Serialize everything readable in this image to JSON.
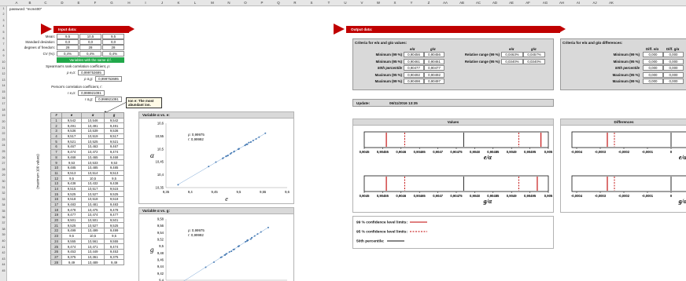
{
  "sheet": {
    "columns": [
      "A",
      "B",
      "C",
      "D",
      "E",
      "F",
      "G",
      "H",
      "I",
      "J",
      "K",
      "L",
      "M",
      "N",
      "O",
      "P",
      "Q",
      "R",
      "S",
      "T",
      "U",
      "V",
      "W",
      "X",
      "Y",
      "Z",
      "AA",
      "AB",
      "AC",
      "AD",
      "AE",
      "AF",
      "AG",
      "AH",
      "AI",
      "AJ",
      "AK"
    ],
    "rows": [
      "1",
      "2",
      "3",
      "4",
      "5",
      "6",
      "7",
      "8",
      "9",
      "10",
      "11",
      "12",
      "13",
      "14",
      "15",
      "16",
      "17",
      "18",
      "19",
      "20",
      "21",
      "22",
      "23",
      "24",
      "25",
      "26",
      "27",
      "28",
      "29",
      "30",
      "31",
      "32",
      "33",
      "34",
      "35",
      "36",
      "37",
      "38",
      "39",
      "40",
      "41",
      "42",
      "43",
      "44",
      "45"
    ],
    "password_note": "password: \"mcm400\""
  },
  "input": {
    "banner": "Input data:",
    "stats_labels": [
      "Mean:",
      "Standard deviation:",
      "degrees of freedom:",
      "CV (%):"
    ],
    "stats_values": [
      [
        "9,5",
        "10,5",
        "9,5"
      ],
      [
        "0,0",
        "0,0",
        "0,0"
      ],
      [
        "28",
        "28",
        "28"
      ],
      [
        "0,4%",
        "0,4%",
        "0,4%"
      ]
    ],
    "green_note": "Variables with the same d.f.",
    "spearman_label": "Spearman's rank correlation coefficient, ρ:",
    "rho_ea_label": "ρ e,α:",
    "rho_ea_value": "0,999753695",
    "rho_ag_label": "ρ α,g:",
    "rho_ag_value": "0,999753695",
    "pearson_label": "Person's correlation coefficient, r:",
    "r_ea_label": "r e,α:",
    "r_ea_value": "0,999921091",
    "r_ag_label": "r α,g:",
    "r_ag_value": "0,999921091",
    "note": "Ion e: The most abundant ion.",
    "vertical_label": "(maximum 100 values)",
    "table_headers": [
      "#",
      "e",
      "α",
      "g"
    ],
    "table_rows": [
      [
        "1",
        "9,542",
        "10,546",
        "9,542"
      ],
      [
        "2",
        "9,491",
        "10,491",
        "9,491"
      ],
      [
        "3",
        "9,536",
        "10,539",
        "9,536"
      ],
      [
        "4",
        "9,517",
        "10,519",
        "9,517"
      ],
      [
        "5",
        "9,521",
        "10,525",
        "9,521"
      ],
      [
        "6",
        "9,467",
        "10,463",
        "9,467"
      ],
      [
        "7",
        "9,474",
        "10,472",
        "9,474"
      ],
      [
        "8",
        "9,468",
        "10,465",
        "9,468"
      ],
      [
        "9",
        "9,53",
        "10,533",
        "9,53"
      ],
      [
        "10",
        "9,485",
        "10,485",
        "9,485"
      ],
      [
        "11",
        "9,513",
        "10,514",
        "9,513"
      ],
      [
        "12",
        "9,5",
        "10,5",
        "9,5"
      ],
      [
        "13",
        "9,438",
        "10,432",
        "9,438"
      ],
      [
        "14",
        "9,515",
        "10,517",
        "9,515"
      ],
      [
        "15",
        "9,525",
        "10,527",
        "9,525"
      ],
      [
        "16",
        "9,518",
        "10,518",
        "9,518"
      ],
      [
        "17",
        "9,483",
        "10,481",
        "9,483"
      ],
      [
        "18",
        "9,478",
        "10,475",
        "9,478"
      ],
      [
        "19",
        "9,477",
        "10,474",
        "9,477"
      ],
      [
        "20",
        "9,501",
        "10,501",
        "9,501"
      ],
      [
        "21",
        "9,525",
        "10,527",
        "9,525"
      ],
      [
        "22",
        "9,499",
        "10,499",
        "9,499"
      ],
      [
        "23",
        "9,5",
        "10,5",
        "9,5"
      ],
      [
        "24",
        "9,555",
        "10,561",
        "9,555"
      ],
      [
        "25",
        "9,474",
        "10,471",
        "9,474"
      ],
      [
        "26",
        "9,453",
        "10,449",
        "9,453"
      ],
      [
        "27",
        "9,375",
        "10,361",
        "9,375"
      ],
      [
        "28",
        "9,49",
        "10,489",
        "9,49"
      ]
    ]
  },
  "scatter1": {
    "title": "Variable α vs. e:",
    "ylabel": "α",
    "xlabel": "e",
    "rho": "ρ: 0,99975",
    "r": "r: 0,99992",
    "yticks": [
      "10,6",
      "10,55",
      "10,5",
      "10,45",
      "10,4",
      "10,35"
    ],
    "xticks": [
      "9,35",
      "9,4",
      "9,45",
      "9,5",
      "9,55",
      "9,6"
    ]
  },
  "scatter2": {
    "title": "Variable α vs. g:",
    "ylabel": "g",
    "rho": "ρ: 0,99975",
    "r": "r: 0,99992",
    "yticks": [
      "9,58",
      "9,56",
      "9,54",
      "9,52",
      "9,5",
      "9,48",
      "9,46",
      "9,44",
      "9,42",
      "9,4"
    ]
  },
  "output": {
    "banner": "Output data:",
    "criteria_title": "Criteria for e/α and g/α values:",
    "col_headers": [
      "e/α",
      "g/α"
    ],
    "rows": [
      {
        "label": "Minimum (99 %)",
        "v1": "0,90456",
        "v2": "0,90456"
      },
      {
        "label": "Minimum (95 %)",
        "v1": "0,90461",
        "v2": "0,90461"
      },
      {
        "label": "50th percentile",
        "v1": "0,90477",
        "v2": "0,90477"
      },
      {
        "label": "Maximum (95 %)",
        "v1": "0,90492",
        "v2": "0,90492"
      },
      {
        "label": "Maximum (99 %)",
        "v1": "0,90498",
        "v2": "0,90497"
      }
    ],
    "relrange_headers": [
      "e/α",
      "g/α"
    ],
    "relrange": [
      {
        "label": "Relative range (99 %)",
        "v1": "0,0463%",
        "v2": "0,0457%"
      },
      {
        "label": "Relative range (95 %)",
        "v1": "0,0340%",
        "v2": "0,0340%"
      }
    ],
    "update_label": "Update:",
    "update_value": "06/11/2016 13:35",
    "values_title": "Values",
    "axis_ticks": [
      "0,9045",
      "0,90455",
      "0,9046",
      "0,90465",
      "0,9047",
      "0,90475",
      "0,9048",
      "0,90485",
      "0,9049",
      "0,90495",
      "0,905"
    ],
    "axis1_label": "e/α",
    "axis2_label": "g/α",
    "legend": {
      "l99": "99 % confidence level limits:",
      "l95": "95 % confidence level limits:",
      "l50": "50th percentile:"
    }
  },
  "differences": {
    "criteria_title": "Criteria for e/α and g/α differences:",
    "col_headers": [
      "Diff. e/α",
      "Diff. g/α"
    ],
    "rows": [
      {
        "label": "Minimum (99 %)",
        "v1": "0,000",
        "v2": "0,000"
      },
      {
        "label": "Minimum (95 %)",
        "v1": "0,000",
        "v2": "0,000"
      },
      {
        "label": "50th percentile",
        "v1": "0,000",
        "v2": "0,000"
      },
      {
        "label": "Maximum (95 %)",
        "v1": "0,000",
        "v2": "0,000"
      },
      {
        "label": "Maximum (99 %)",
        "v1": "0,000",
        "v2": "0,000"
      }
    ],
    "title": "Differences",
    "axis_ticks": [
      "-0,0004",
      "-0,0003",
      "-0,0002",
      "-0,0001",
      "0",
      "0,00"
    ],
    "axis1_label": "e/α",
    "axis2_label": "g/α"
  },
  "colors": {
    "accent": "#c00000",
    "green": "#21a84a",
    "grey_panel": "#d9d9d9",
    "scatter_point": "#4a7db5"
  }
}
